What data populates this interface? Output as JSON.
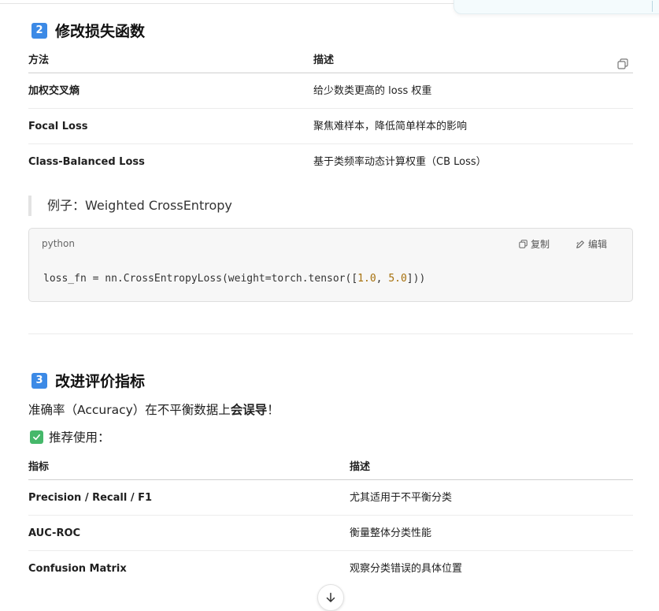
{
  "section2": {
    "badge": "2",
    "title": "修改损失函数",
    "table": {
      "headers": [
        "方法",
        "描述"
      ],
      "rows": [
        [
          "加权交叉熵",
          "给少数类更高的 loss 权重"
        ],
        [
          "Focal Loss",
          "聚焦难样本，降低简单样本的影响"
        ],
        [
          "Class-Balanced Loss",
          "基于类频率动态计算权重（CB Loss）"
        ]
      ]
    },
    "quote": "例子：Weighted CrossEntropy",
    "code": {
      "language": "python",
      "copy_label": "复制",
      "edit_label": "编辑",
      "line_prefix": "loss_fn = nn.CrossEntropyLoss(weight=torch.tensor([",
      "num1": "1.0",
      "sep": ", ",
      "num2": "5.0",
      "line_suffix": "]))"
    }
  },
  "section3": {
    "badge": "3",
    "title": "改进评价指标",
    "para_before": "准确率（Accuracy）在不平衡数据上",
    "para_bold": "会误导",
    "para_after": "！",
    "recommend": "推荐使用：",
    "table": {
      "headers": [
        "指标",
        "描述"
      ],
      "rows": [
        [
          "Precision / Recall / F1",
          "尤其适用于不平衡分类"
        ],
        [
          "AUC-ROC",
          "衡量整体分类性能"
        ],
        [
          "Confusion Matrix",
          "观察分类错误的具体位置"
        ]
      ]
    }
  },
  "icons": {
    "copy_table": "copy-icon",
    "copy_code": "copy-icon",
    "edit_code": "edit-icon",
    "check": "check-icon",
    "scroll_down": "arrow-down-icon"
  },
  "colors": {
    "badge": "#3c8ae6",
    "check": "#45b86a",
    "number_literal": "#a6700c"
  }
}
